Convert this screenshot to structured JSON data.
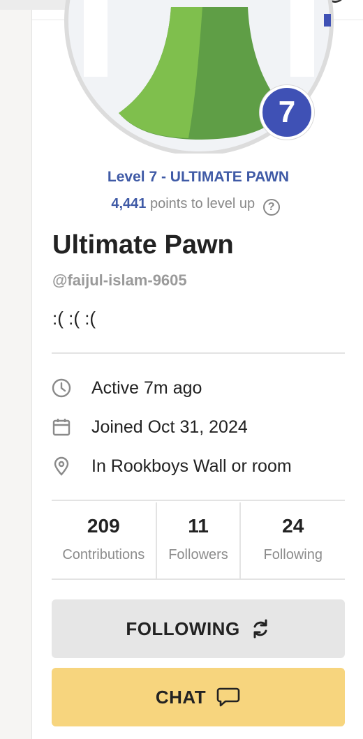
{
  "profile": {
    "level_badge": "7",
    "level_text": "Level 7 - ULTIMATE PAWN",
    "points_value": "4,441",
    "points_suffix": "points to level up",
    "help_symbol": "?",
    "name": "Ultimate Pawn",
    "handle": "@faijul-islam-9605",
    "bio": ":( :( :("
  },
  "info": {
    "active": "Active 7m ago",
    "joined": "Joined Oct 31, 2024",
    "location": "In Rookboys Wall or room"
  },
  "stats": [
    {
      "value": "209",
      "label": "Contributions"
    },
    {
      "value": "11",
      "label": "Followers"
    },
    {
      "value": "24",
      "label": "Following"
    }
  ],
  "actions": {
    "following_label": "FOLLOWING",
    "chat_label": "CHAT"
  },
  "colors": {
    "accent_blue": "#3f51b5",
    "level_text": "#3f5aa6",
    "avatar_green": "#6aa84f",
    "chat_button": "#f7d57e",
    "following_button": "#e6e6e6"
  },
  "icons": {
    "active": "clock-icon",
    "joined": "calendar-icon",
    "location": "map-pin-icon",
    "following": "refresh-icon",
    "chat": "chat-bubble-icon"
  }
}
